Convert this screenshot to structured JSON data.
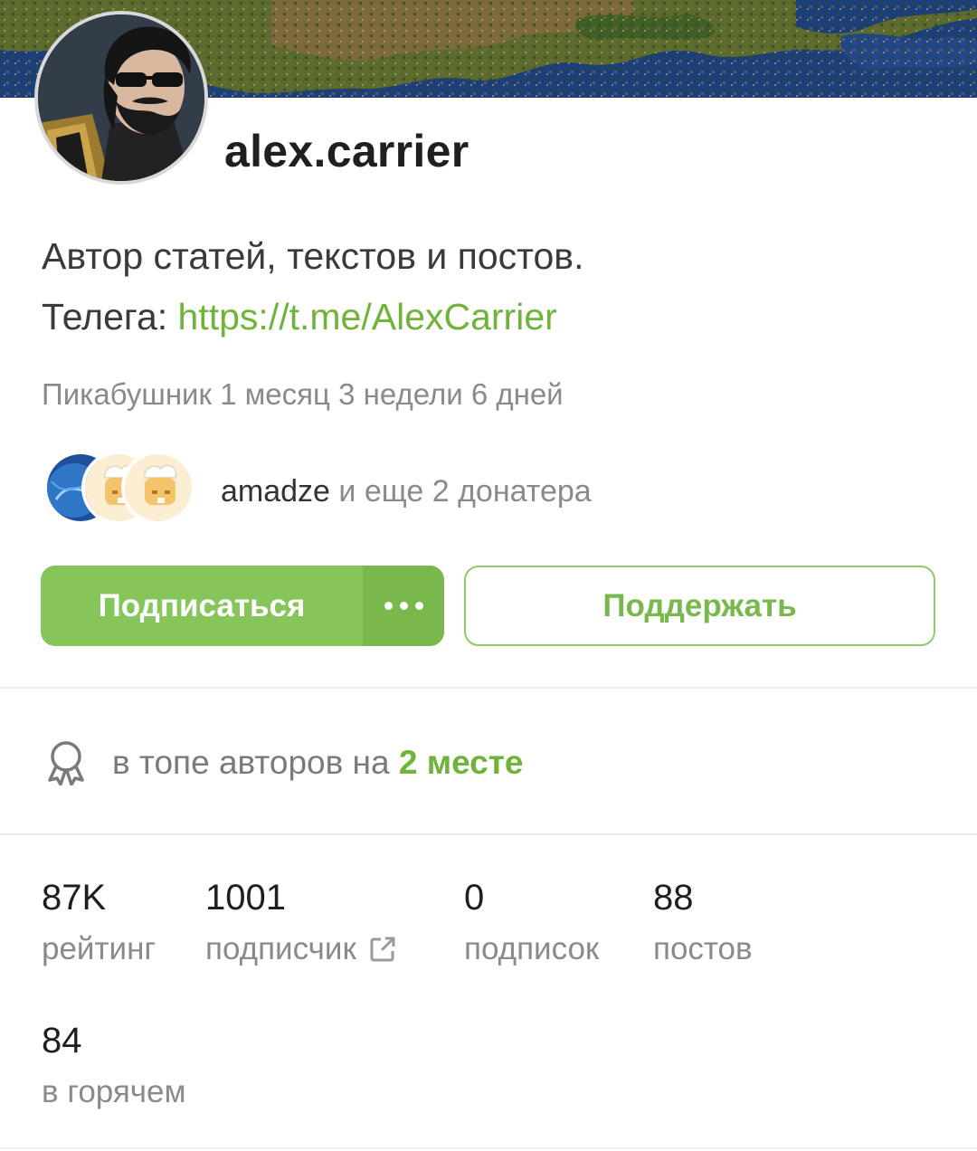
{
  "profile": {
    "username": "alex.carrier",
    "bio_line1": "Автор статей, текстов и постов.",
    "bio_line2_prefix": "Телега: ",
    "bio_link": "https://t.me/AlexCarrier",
    "member_since": "Пикабушник 1 месяц 3 недели 6 дней"
  },
  "donators": {
    "name": "amadze",
    "rest": " и еще 2 донатера"
  },
  "actions": {
    "subscribe_label": "Подписаться",
    "donate_label": "Поддержать"
  },
  "ranking": {
    "prefix": "в топе авторов на ",
    "place": "2 месте"
  },
  "stats": [
    {
      "value": "87K",
      "label": "рейтинг"
    },
    {
      "value": "1001",
      "label": "подписчик"
    },
    {
      "value": "0",
      "label": "подписок"
    },
    {
      "value": "88",
      "label": "постов"
    },
    {
      "value": "84",
      "label": "в горячем"
    }
  ],
  "colors": {
    "accent": "#86c55a",
    "accent_dark": "#78b84c",
    "link": "#6fb33b",
    "muted_text": "#8a8a8a"
  }
}
